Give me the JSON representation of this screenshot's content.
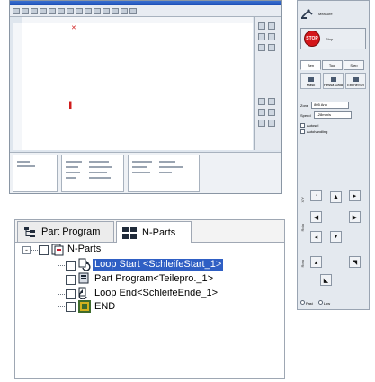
{
  "control_panel": {
    "measure_label": "Measure",
    "stop_label": "Stop",
    "stop_icon_text": "STOP",
    "tabs": [
      "Ben",
      "Tool",
      "Step"
    ],
    "subtools": [
      "Mask",
      "Hessa Data",
      "Ebene/Sei"
    ],
    "zone_label": "Zone",
    "zone_value": "805 Ann",
    "speed_label": "Speed",
    "speed_value": "128mm/s",
    "check_1": "Autosel",
    "check_2": "Autohandling",
    "axis_labels": [
      "X/Y",
      "Rota",
      "Rota"
    ],
    "radio_1": "Fast",
    "radio_2": "Low"
  },
  "tree_panel": {
    "tabs": [
      {
        "label": "Part Program"
      },
      {
        "label": "N-Parts"
      }
    ],
    "root": {
      "label": "N-Parts"
    },
    "children": [
      {
        "label": "Loop Start <SchleifeStart_1>",
        "selected": true
      },
      {
        "label": "Part Program<Teilepro._1>",
        "selected": false
      },
      {
        "label": "Loop End<SchleifeEnde_1>",
        "selected": false
      },
      {
        "label": "END",
        "selected": false
      }
    ]
  }
}
